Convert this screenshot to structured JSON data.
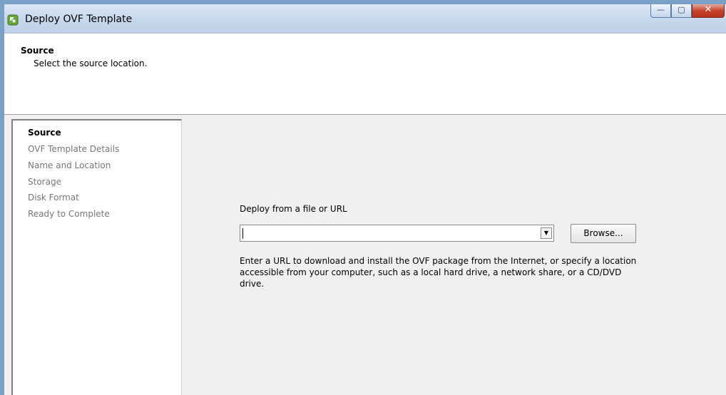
{
  "window": {
    "title": "Deploy OVF Template",
    "controls": {
      "minimize": "—",
      "maximize": "▢",
      "close": "✕"
    }
  },
  "header": {
    "title": "Source",
    "subtitle": "Select the source location."
  },
  "sidebar": {
    "items": [
      {
        "label": "Source",
        "active": true
      },
      {
        "label": "OVF Template Details",
        "active": false
      },
      {
        "label": "Name and Location",
        "active": false
      },
      {
        "label": "Storage",
        "active": false
      },
      {
        "label": "Disk Format",
        "active": false
      },
      {
        "label": "Ready to Complete",
        "active": false
      }
    ]
  },
  "main": {
    "deploy_label": "Deploy from a file or URL",
    "source_input": {
      "value": "",
      "placeholder": ""
    },
    "dropdown_arrow": "▼",
    "browse_label": "Browse...",
    "help_text": "Enter a URL to download and install the OVF package from the Internet, or specify a location accessible from your computer, such as a local hard drive, a network share, or a CD/DVD drive."
  },
  "icons": {
    "app": "vsphere-app-icon",
    "minimize": "minimize-icon",
    "maximize": "maximize-icon",
    "close": "close-icon",
    "dropdown": "chevron-down-icon"
  },
  "colors": {
    "accent": "#6aa83a",
    "titlebar": "#c9daee",
    "close": "#c7432b"
  }
}
